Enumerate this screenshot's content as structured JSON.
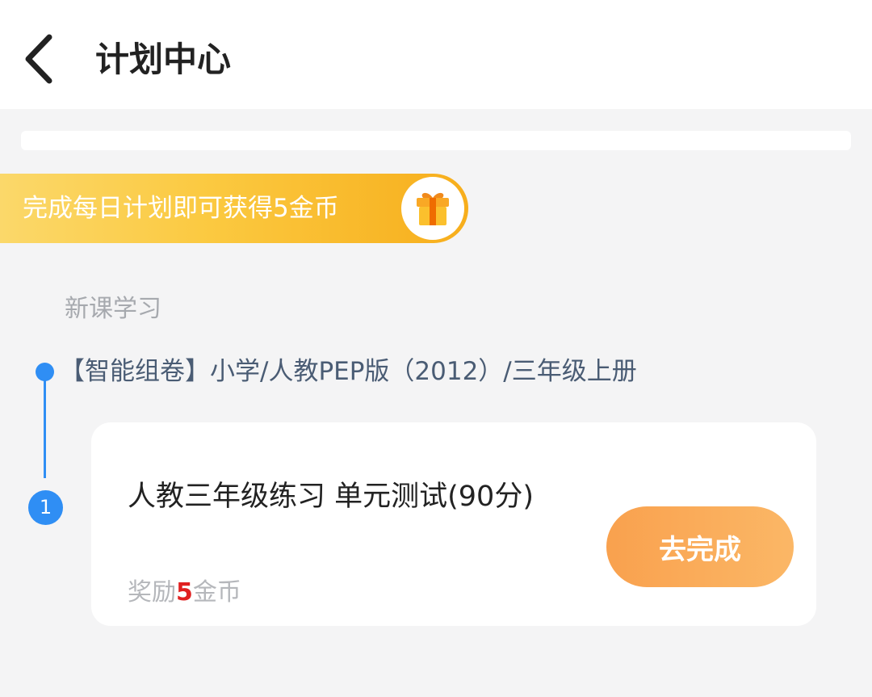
{
  "header": {
    "title": "计划中心",
    "back_icon": "chevron-left-icon"
  },
  "banner": {
    "text": "完成每日计划即可获得5金币",
    "icon": "gift-icon"
  },
  "section": {
    "label": "新课学习"
  },
  "course": {
    "title": "【智能组卷】小学/人教PEP版（2012）/三年级上册"
  },
  "tasks": [
    {
      "index": "1",
      "title": "人教三年级练习  单元测试(90分)",
      "reward_prefix": "奖励",
      "reward_amount": "5",
      "reward_suffix": "金币",
      "action_label": "去完成"
    }
  ],
  "colors": {
    "accent_blue": "#2f8ef4",
    "banner_orange": "#fbc940",
    "button_orange": "#f9a14e",
    "reward_red": "#e02020"
  }
}
